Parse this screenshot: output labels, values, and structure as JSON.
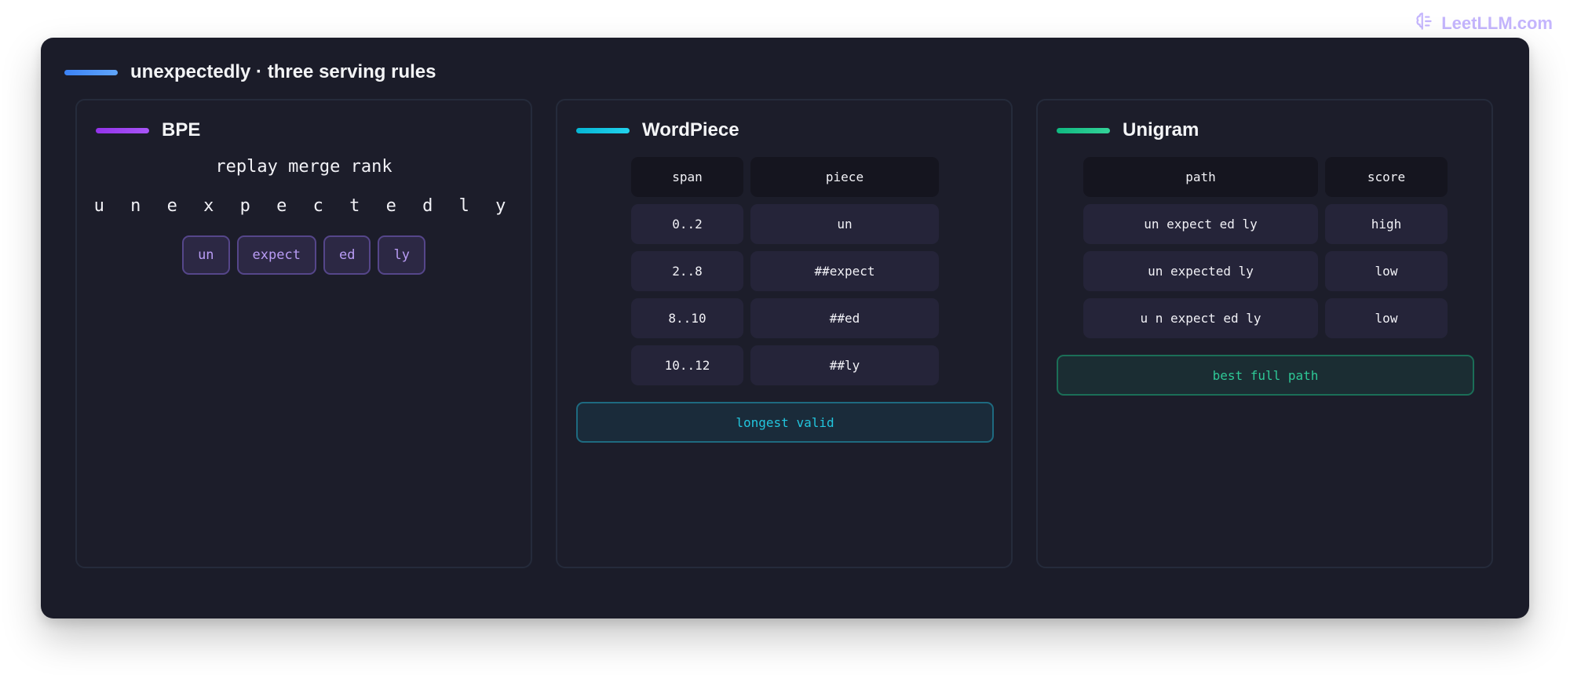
{
  "brand": {
    "text": "LeetLLM.com",
    "icon": "brain-icon",
    "color": "#c4b5fd"
  },
  "frame": {
    "title": "unexpectedly · three serving rules",
    "accent": "#3b82f6"
  },
  "panels": {
    "bpe": {
      "title": "BPE",
      "accent": "#9333ea",
      "rule": "replay merge rank",
      "characters": "u n e x p e c t e d l y",
      "tokens": [
        "un",
        "expect",
        "ed",
        "ly"
      ]
    },
    "wordpiece": {
      "title": "WordPiece",
      "accent": "#06b6d4",
      "headers": {
        "span": "span",
        "piece": "piece"
      },
      "rows": [
        {
          "span": "0..2",
          "piece": "un"
        },
        {
          "span": "2..8",
          "piece": "##expect"
        },
        {
          "span": "8..10",
          "piece": "##ed"
        },
        {
          "span": "10..12",
          "piece": "##ly"
        }
      ],
      "note": "longest valid"
    },
    "unigram": {
      "title": "Unigram",
      "accent": "#10b981",
      "headers": {
        "path": "path",
        "score": "score"
      },
      "rows": [
        {
          "path": "un expect ed ly",
          "score": "high"
        },
        {
          "path": "un expected ly",
          "score": "low"
        },
        {
          "path": "u n expect ed ly",
          "score": "low"
        }
      ],
      "note": "best full path"
    }
  }
}
